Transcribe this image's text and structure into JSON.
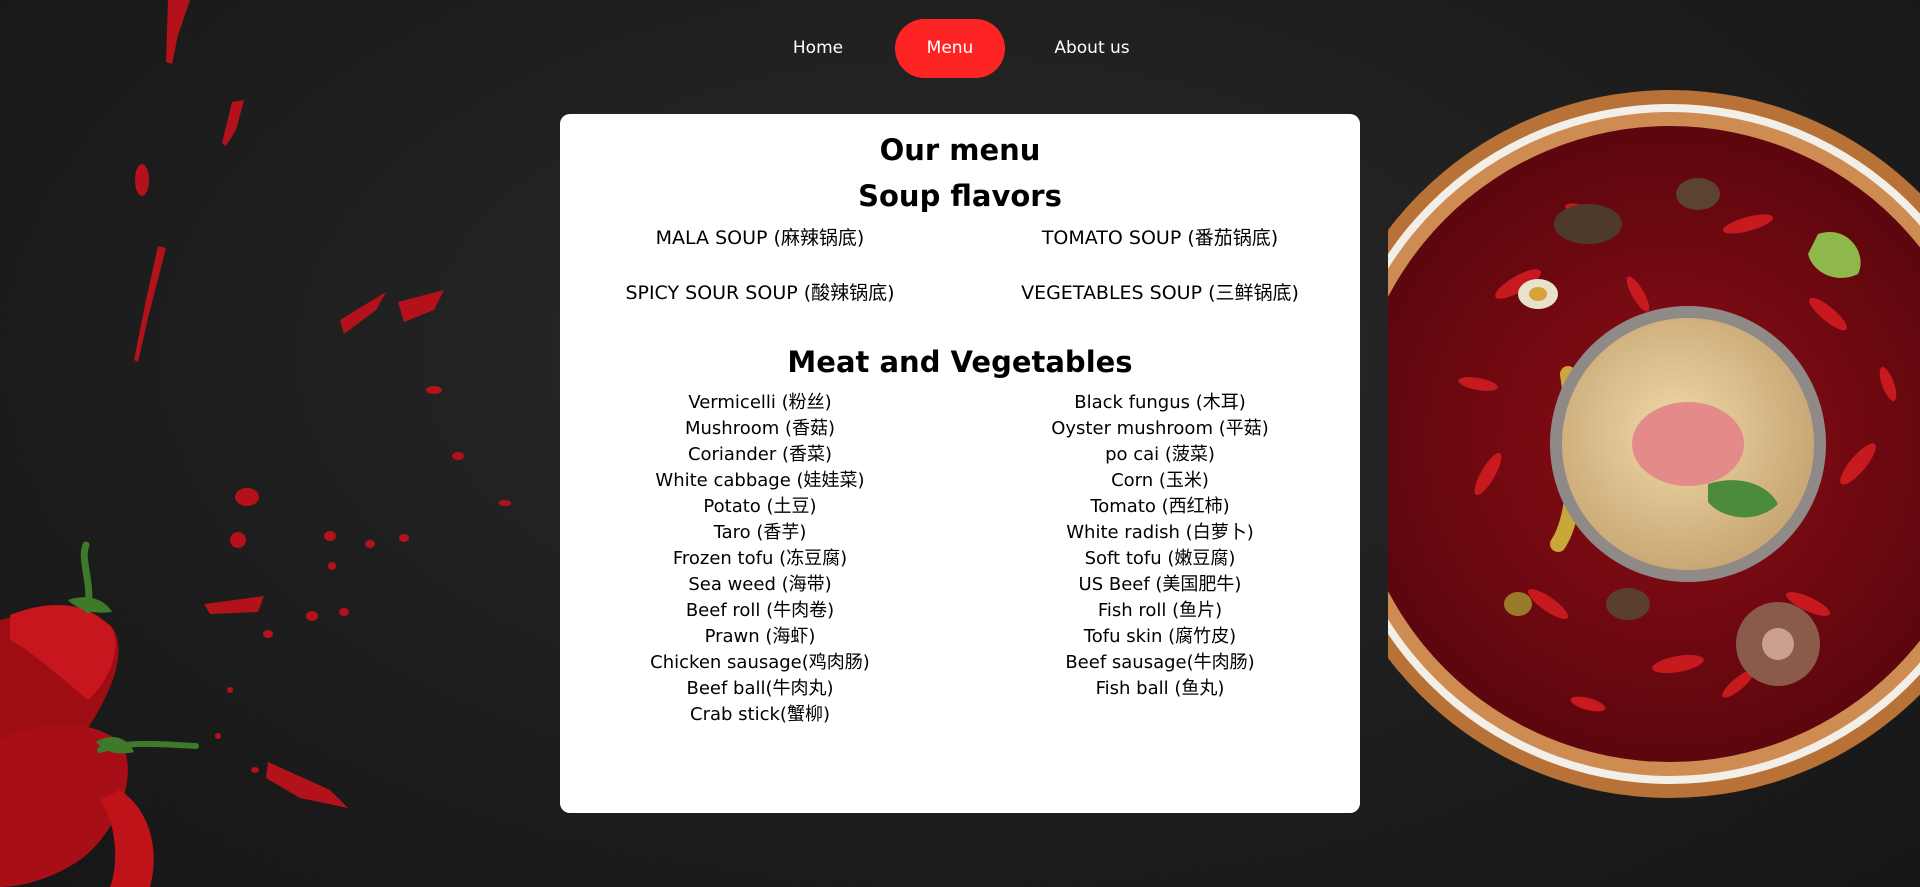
{
  "nav": {
    "items": [
      {
        "label": "Home",
        "active": false
      },
      {
        "label": "Menu",
        "active": true
      },
      {
        "label": "About us",
        "active": false
      }
    ],
    "active_color": "#ff2424"
  },
  "menu": {
    "title": "Our menu",
    "soup_heading": "Soup flavors",
    "soups": [
      "MALA SOUP (麻辣锅底)",
      "TOMATO SOUP (番茄锅底)",
      "SPICY SOUR SOUP (酸辣锅底)",
      "VEGETABLES SOUP (三鲜锅底)"
    ],
    "items_heading": "Meat and Vegetables",
    "left_items": [
      "Vermicelli (粉丝)",
      "Mushroom (香菇)",
      "Coriander (香菜)",
      "White cabbage (娃娃菜)",
      "Potato (土豆)",
      "Taro (香芋)",
      "Frozen tofu (冻豆腐)",
      "Sea weed (海带)",
      "Beef roll (牛肉卷)",
      "Prawn (海虾)",
      "Chicken sausage(鸡肉肠)",
      "Beef ball(牛肉丸)",
      "Crab stick(蟹柳)"
    ],
    "right_items": [
      "Black fungus (木耳)",
      "Oyster mushroom (平菇)",
      "po cai (菠菜)",
      "Corn (玉米)",
      "Tomato (西红柿)",
      "White radish (白萝卜)",
      "Soft tofu (嫩豆腐)",
      "US Beef (美国肥牛)",
      "Fish roll (鱼片)",
      "Tofu skin (腐竹皮)",
      "Beef sausage(牛肉肠)",
      "Fish ball (鱼丸)"
    ]
  },
  "decor": {
    "left": "chili-splash-image",
    "right": "hotpot-bowl-image",
    "accent_red": "#c0141c"
  }
}
